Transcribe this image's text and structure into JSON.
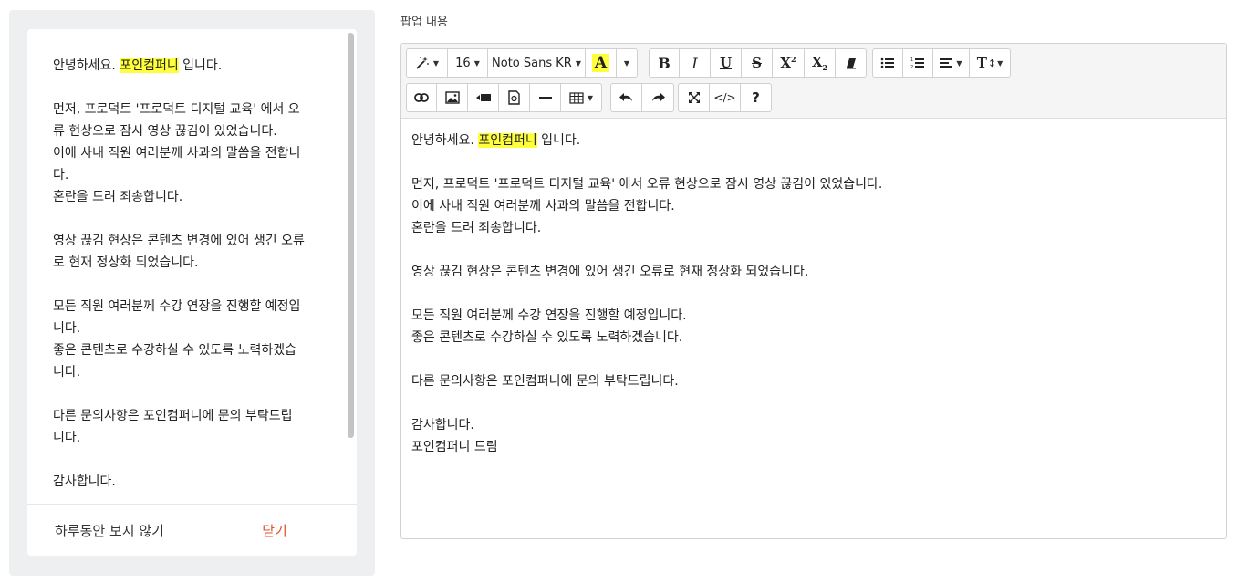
{
  "popup": {
    "lines": [
      {
        "text": "안녕하세요. ",
        "highlight": "포인컴퍼니",
        "after": " 입니다."
      },
      {
        "text": ""
      },
      {
        "text": "먼저, 프로덕트 '프로덕트 디지털 교육' 에서 오"
      },
      {
        "text": "류 현상으로 잠시 영상 끊김이 있었습니다."
      },
      {
        "text": "이에 사내 직원 여러분께 사과의 말씀을 전합니"
      },
      {
        "text": "다."
      },
      {
        "text": "혼란을 드려 죄송합니다."
      },
      {
        "text": ""
      },
      {
        "text": "영상 끊김 현상은 콘텐츠 변경에 있어 생긴 오류"
      },
      {
        "text": "로 현재 정상화 되었습니다."
      },
      {
        "text": ""
      },
      {
        "text": "모든 직원 여러분께 수강 연장을 진행할 예정입"
      },
      {
        "text": "니다."
      },
      {
        "text": "좋은 콘텐츠로 수강하실 수 있도록 노력하겠습"
      },
      {
        "text": "니다."
      },
      {
        "text": ""
      },
      {
        "text": "다른 문의사항은 포인컴퍼니에 문의 부탁드립"
      },
      {
        "text": "니다."
      },
      {
        "text": ""
      },
      {
        "text": "감사합니다."
      }
    ],
    "dont_show_today": "하루동안 보지 않기",
    "close": "닫기"
  },
  "editor": {
    "label": "팝업 내용",
    "toolbar": {
      "font_size": "16",
      "font_family": "Noto Sans KR",
      "font_color_letter": "A",
      "bold": "B",
      "italic": "I",
      "underline": "U",
      "strike": "S",
      "superscript": "X",
      "subscript": "X",
      "text_size_label": "T",
      "help": "?",
      "code": "</>",
      "icons": [
        "magic-icon",
        "bullet-list-icon",
        "ordered-list-icon",
        "align-icon",
        "line-height-icon",
        "link-icon",
        "image-icon",
        "video-icon",
        "file-icon",
        "horizontal-rule-icon",
        "table-icon",
        "undo-icon",
        "redo-icon",
        "fullscreen-icon",
        "code-view-icon",
        "help-icon",
        "eraser-icon"
      ]
    },
    "lines": [
      {
        "text": "안녕하세요. ",
        "highlight": "포인컴퍼니",
        "after": " 입니다."
      },
      {
        "text": ""
      },
      {
        "text": "먼저, 프로덕트 '프로덕트 디지털 교육' 에서 오류 현상으로 잠시 영상 끊김이 있었습니다."
      },
      {
        "text": "이에 사내 직원 여러분께 사과의 말씀을 전합니다."
      },
      {
        "text": "혼란을 드려 죄송합니다."
      },
      {
        "text": ""
      },
      {
        "text": "영상 끊김 현상은 콘텐츠 변경에 있어 생긴 오류로 현재 정상화 되었습니다."
      },
      {
        "text": ""
      },
      {
        "text": "모든 직원 여러분께 수강 연장을 진행할 예정입니다."
      },
      {
        "text": "좋은 콘텐츠로 수강하실 수 있도록 노력하겠습니다."
      },
      {
        "text": ""
      },
      {
        "text": "다른 문의사항은 포인컴퍼니에 문의 부탁드립니다."
      },
      {
        "text": ""
      },
      {
        "text": "감사합니다."
      },
      {
        "text": "포인컴퍼니 드림"
      }
    ]
  },
  "colors": {
    "highlight": "#ffff3c",
    "close_button": "#e0522c",
    "preview_bg": "#eeeff1"
  }
}
